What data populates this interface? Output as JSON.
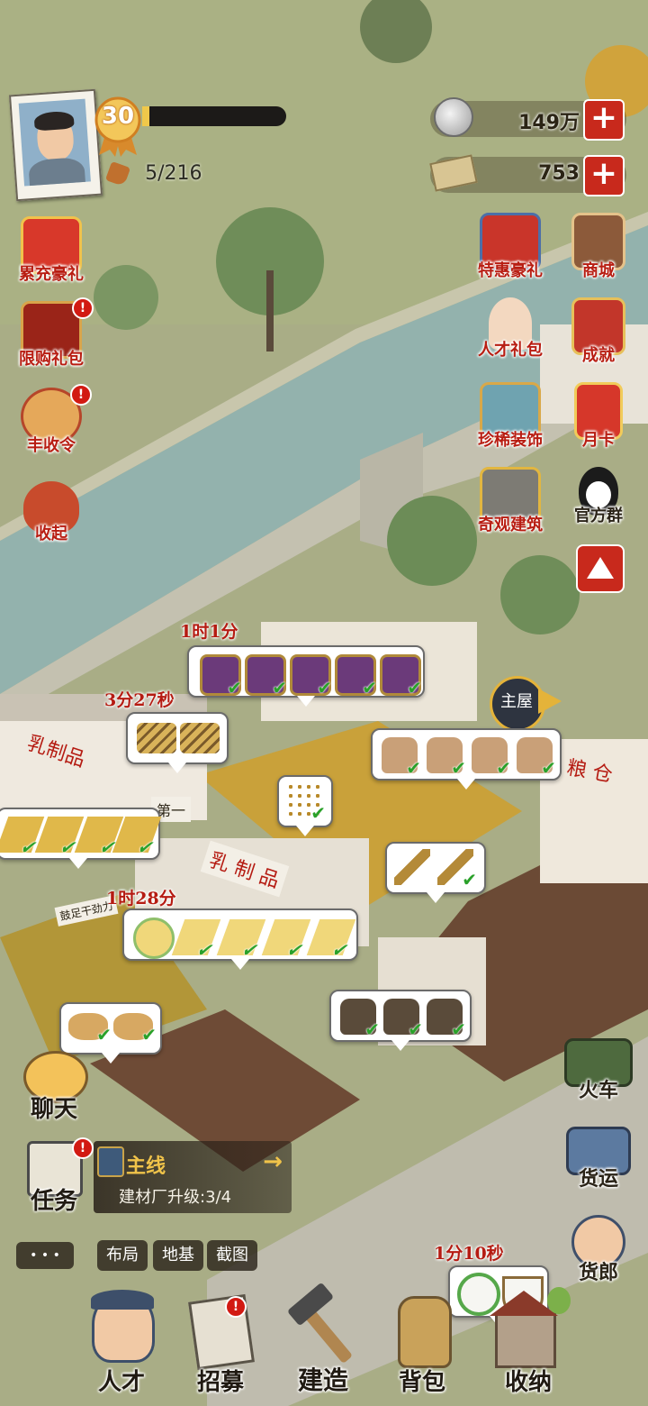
{
  "player": {
    "level": "30",
    "energy": "5/216",
    "exp_progress": 0.05
  },
  "currency": {
    "silver": "149万",
    "banknotes": "753"
  },
  "left_menu": [
    {
      "label": "累充豪礼",
      "icon": "gift-box-icon",
      "badge": false
    },
    {
      "label": "限购礼包",
      "icon": "treasure-chest-icon",
      "badge": true
    },
    {
      "label": "丰收令",
      "icon": "harvest-medal-icon",
      "badge": true
    },
    {
      "label": "收起",
      "icon": "collapse-sack-icon",
      "badge": false
    }
  ],
  "right_menu": [
    {
      "label": "特惠豪礼",
      "icon": "special-gift-icon"
    },
    {
      "label": "商城",
      "icon": "shop-icon"
    },
    {
      "label": "人才礼包",
      "icon": "talent-girl-icon"
    },
    {
      "label": "成就",
      "icon": "trophy-icon"
    },
    {
      "label": "珍稀装饰",
      "icon": "rare-decoration-icon"
    },
    {
      "label": "月卡",
      "icon": "month-card-icon"
    },
    {
      "label": "奇观建筑",
      "icon": "wonder-building-icon"
    },
    {
      "label": "官方群",
      "icon": "qq-penguin-icon"
    }
  ],
  "timers": {
    "t1": "1时1分",
    "t2": "3分27秒",
    "t3": "1时28分",
    "t4": "1分10秒"
  },
  "map_labels": {
    "main_house": "主屋",
    "dairy": "乳制品",
    "dairy2": "乳 制 品",
    "grain": "粮 仓",
    "first": "第一",
    "slogan": "鼓足干劲力"
  },
  "right_side": [
    {
      "label": "火车",
      "icon": "train-icon"
    },
    {
      "label": "货运",
      "icon": "truck-icon"
    },
    {
      "label": "货郎",
      "icon": "peddler-icon"
    }
  ],
  "chat": {
    "label": "聊天"
  },
  "task": {
    "label": "任务",
    "quest_title": "主线",
    "quest_desc": "建材厂升级:3/4"
  },
  "tools": {
    "more": "• • •",
    "layout": "布局",
    "foundation": "地基",
    "screenshot": "截图"
  },
  "bottom_nav": [
    {
      "label": "人才",
      "icon": "worker-portrait-icon",
      "badge": false
    },
    {
      "label": "招募",
      "icon": "recruit-poster-icon",
      "badge": true
    },
    {
      "label": "建造",
      "icon": "hammer-icon",
      "badge": false
    },
    {
      "label": "背包",
      "icon": "backpack-icon",
      "badge": false
    },
    {
      "label": "收纳",
      "icon": "storage-house-icon",
      "badge": false
    }
  ],
  "colors": {
    "accent_red": "#b81d12",
    "grass": "#a9ad86",
    "river": "#93b2ad",
    "soil": "#6b4a35",
    "wheat": "#c9a13a"
  }
}
